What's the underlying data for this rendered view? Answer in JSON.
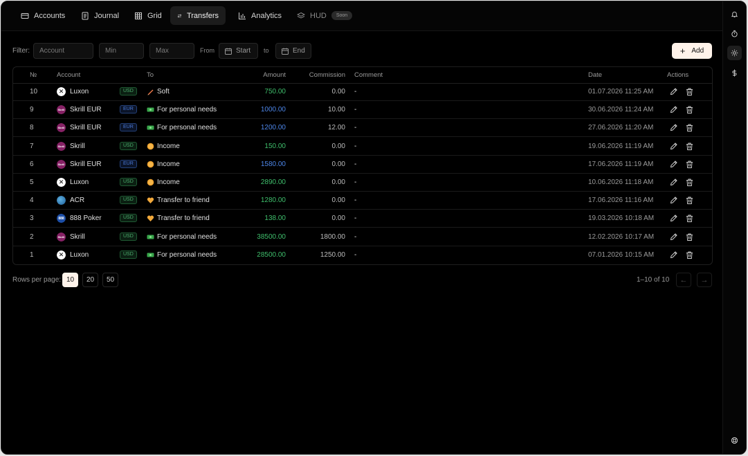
{
  "nav": {
    "tabs": [
      {
        "label": "Accounts",
        "icon": "wallet-icon"
      },
      {
        "label": "Journal",
        "icon": "journal-icon"
      },
      {
        "label": "Grid",
        "icon": "grid-icon"
      },
      {
        "label": "Transfers",
        "icon": "transfer-icon",
        "active": true
      },
      {
        "label": "Analytics",
        "icon": "bar-chart-icon"
      },
      {
        "label": "HUD",
        "icon": "layers-icon",
        "badge": "Soon"
      }
    ]
  },
  "rail": {
    "icons": [
      "bell-icon",
      "timer-icon",
      "sun-icon",
      "dollar-icon",
      "lifebuoy-icon"
    ]
  },
  "filter": {
    "label": "Filter:",
    "account_placeholder": "Account",
    "min_placeholder": "Min",
    "max_placeholder": "Max",
    "from_label": "From",
    "start_label": "Start",
    "to_label": "to",
    "end_label": "End",
    "add_label": "Add"
  },
  "table": {
    "headers": {
      "no": "№",
      "account": "Account",
      "to": "To",
      "amount": "Amount",
      "commission": "Commission",
      "comment": "Comment",
      "date": "Date",
      "actions": "Actions"
    },
    "rows": [
      {
        "no": "10",
        "account": "Luxon",
        "acc_icon": "luxon",
        "currency": "USD",
        "to": "Soft",
        "to_icon": "pencil-emoji-icon",
        "amount": "750.00",
        "commission": "0.00",
        "comment": "-",
        "date": "01.07.2026 11:25 AM"
      },
      {
        "no": "9",
        "account": "Skrill EUR",
        "acc_icon": "skrill",
        "currency": "EUR",
        "to": "For personal needs",
        "to_icon": "money-icon",
        "amount": "1000.00",
        "commission": "10.00",
        "comment": "-",
        "date": "30.06.2026 11:24 AM"
      },
      {
        "no": "8",
        "account": "Skrill EUR",
        "acc_icon": "skrill",
        "currency": "EUR",
        "to": "For personal needs",
        "to_icon": "money-icon",
        "amount": "1200.00",
        "commission": "12.00",
        "comment": "-",
        "date": "27.06.2026 11:20 AM"
      },
      {
        "no": "7",
        "account": "Skrill",
        "acc_icon": "skrill",
        "currency": "USD",
        "to": "Income",
        "to_icon": "coin-icon",
        "amount": "150.00",
        "commission": "0.00",
        "comment": "-",
        "date": "19.06.2026 11:19 AM"
      },
      {
        "no": "6",
        "account": "Skrill EUR",
        "acc_icon": "skrill",
        "currency": "EUR",
        "to": "Income",
        "to_icon": "coin-icon",
        "amount": "1580.00",
        "commission": "0.00",
        "comment": "-",
        "date": "17.06.2026 11:19 AM"
      },
      {
        "no": "5",
        "account": "Luxon",
        "acc_icon": "luxon",
        "currency": "USD",
        "to": "Income",
        "to_icon": "coin-icon",
        "amount": "2890.00",
        "commission": "0.00",
        "comment": "-",
        "date": "10.06.2026 11:18 AM"
      },
      {
        "no": "4",
        "account": "ACR",
        "acc_icon": "acr",
        "currency": "USD",
        "to": "Transfer to friend",
        "to_icon": "heart-icon",
        "amount": "1280.00",
        "commission": "0.00",
        "comment": "-",
        "date": "17.06.2026 11:16 AM"
      },
      {
        "no": "3",
        "account": "888 Poker",
        "acc_icon": "888",
        "currency": "USD",
        "to": "Transfer to friend",
        "to_icon": "heart-icon",
        "amount": "138.00",
        "commission": "0.00",
        "comment": "-",
        "date": "19.03.2026 10:18 AM"
      },
      {
        "no": "2",
        "account": "Skrill",
        "acc_icon": "skrill",
        "currency": "USD",
        "to": "For personal needs",
        "to_icon": "money-icon",
        "amount": "38500.00",
        "commission": "1800.00",
        "comment": "-",
        "date": "12.02.2026 10:17 AM"
      },
      {
        "no": "1",
        "account": "Luxon",
        "acc_icon": "luxon",
        "currency": "USD",
        "to": "For personal needs",
        "to_icon": "money-icon",
        "amount": "28500.00",
        "commission": "1250.00",
        "comment": "-",
        "date": "07.01.2026 10:15 AM"
      }
    ]
  },
  "pagination": {
    "rows_per_page_label": "Rows per page:",
    "options": [
      "10",
      "20",
      "50"
    ],
    "selected": "10",
    "range": "1–10 of 10",
    "prev": "←",
    "next": "→"
  },
  "colors": {
    "usd": "#3fbf6c",
    "eur": "#4d86e8",
    "accent": "#fff3ea"
  }
}
